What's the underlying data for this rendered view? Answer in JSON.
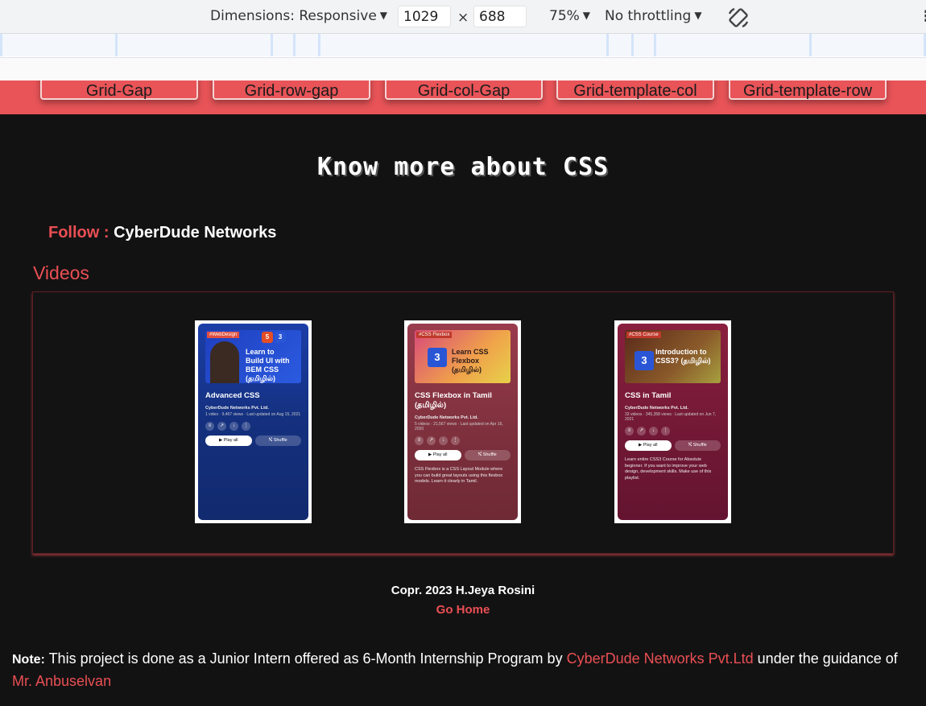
{
  "devtools": {
    "dimensions_label": "Dimensions: Responsive",
    "width_value": "1029",
    "times": "×",
    "height_value": "688",
    "zoom": "75%",
    "throttling": "No throttling",
    "menu": "⋮"
  },
  "nav": {
    "buttons": [
      "Grid-Gap",
      "Grid-row-gap",
      "Grid-col-Gap",
      "Grid-template-col",
      "Grid-template-row"
    ]
  },
  "heading": "Know more about CSS",
  "follow": {
    "label": "Follow :",
    "name": "CyberDude Networks"
  },
  "videos_title": "Videos",
  "playlists": [
    {
      "tag": "#WebDesign",
      "thumb_text": "Learn to Build UI with BEM CSS (தமிழில்)",
      "title": "Advanced CSS",
      "owner": "CyberDude Networks Pvt. Ltd.",
      "meta": "1 video · 9,467 views · Last updated on Aug 15, 2021",
      "play": "Play all",
      "shuffle": "Shuffle",
      "desc": ""
    },
    {
      "tag": "#CSS Flexbox",
      "thumb_text": "Learn CSS Flexbox (தமிழில்)",
      "title": "CSS Flexbox in Tamil (தமிழில்)",
      "owner": "CyberDude Networks Pvt. Ltd.",
      "meta": "5 videos · 21,567 views · Last updated on Apr 16, 2020",
      "play": "Play all",
      "shuffle": "Shuffle",
      "desc": "CSS Flexbox is a CSS Layout Module where you can build great layouts using this flexbox models. Learn it clearly in Tamil."
    },
    {
      "tag": "#CSS Course",
      "thumb_text": "Introduction to CSS3? (தமிழில்)",
      "title": "CSS in Tamil",
      "owner": "CyberDude Networks Pvt. Ltd.",
      "meta": "33 videos · 345,358 views · Last updated on Jun 7, 2021",
      "play": "Play all",
      "shuffle": "Shuffle",
      "desc": "Learn entire CSS3 Course for Absolute beginner. If you want to improve your web design, development skills. Make use of this playlist."
    }
  ],
  "footer": {
    "copyright": "Copr. 2023 H.Jeya Rosini",
    "go_home": "Go Home",
    "note_label": "Note:",
    "note_text1": " This project is done as a Junior Intern offered as 6-Month Internship Program by ",
    "note_company": "CyberDude Networks Pvt.Ltd",
    "note_text2": " under the guidance of ",
    "note_mentor": "Mr. Anbuselvan"
  },
  "colors": {
    "accent": "#ea4f53",
    "background": "#131213",
    "strip": "#e85458"
  }
}
